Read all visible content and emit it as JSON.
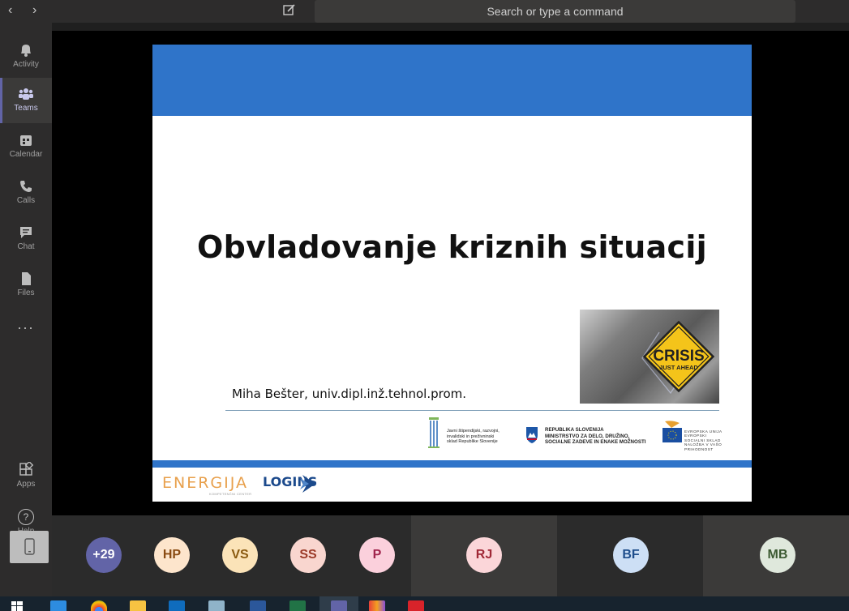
{
  "search": {
    "placeholder": "Search or type a command"
  },
  "rail": {
    "items": [
      {
        "label": "Activity",
        "icon": "bell-icon"
      },
      {
        "label": "Teams",
        "icon": "teams-icon"
      },
      {
        "label": "Calendar",
        "icon": "calendar-icon"
      },
      {
        "label": "Calls",
        "icon": "phone-icon"
      },
      {
        "label": "Chat",
        "icon": "chat-icon"
      },
      {
        "label": "Files",
        "icon": "file-icon"
      }
    ],
    "more": "...",
    "apps": "Apps",
    "help": "Help",
    "help_glyph": "?",
    "active": "Teams"
  },
  "slide": {
    "title": "Obvladovanje kriznih situacij",
    "author": "Miha Bešter, univ.dipl.inž.tehnol.prom.",
    "crisis_sign": {
      "line1": "CRISIS",
      "line2": "JUST AHEAD"
    },
    "fund_text": "Javni štipendijski, razvojni,\ninvalidski in preživninski\nsklad Republike Slovenije",
    "ministry_text": "REPUBLIKA SLOVENIJA\nMINISTRSTVO ZA DELO, DRUŽINO,\nSOCIALNE ZADEVE IN ENAKE MOŽNOSTI",
    "eu_text": "EVROPSKA UNIJA\nEVROPSKI\nSOCIALNI SKLAD\nNALOŽBA V VAŠO PRIHODNOST",
    "energija": "ENERGIJA",
    "energija_sub": "KOMPETENČNI CENTER",
    "logins": "LOGINS"
  },
  "participants": [
    {
      "initials": "+29",
      "bg": "#6264a7",
      "fg": "#ffffff"
    },
    {
      "initials": "HP",
      "bg": "#fde5cc",
      "fg": "#8a4b12"
    },
    {
      "initials": "VS",
      "bg": "#fbe3b8",
      "fg": "#8a5a10"
    },
    {
      "initials": "SS",
      "bg": "#f9d6cf",
      "fg": "#9b3a28"
    },
    {
      "initials": "P",
      "bg": "#fbd0dc",
      "fg": "#a0244c"
    },
    {
      "initials": "RJ",
      "bg": "#fbd6d9",
      "fg": "#a02836"
    },
    {
      "initials": "BF",
      "bg": "#cddff5",
      "fg": "#1f4e8c"
    },
    {
      "initials": "MB",
      "bg": "#dfe8dc",
      "fg": "#3c5a32"
    }
  ],
  "colors": {
    "accent": "#6264a7",
    "slide_blue": "#2f74c9",
    "energija": "#e8a04c",
    "logins": "#1c4a8c"
  }
}
